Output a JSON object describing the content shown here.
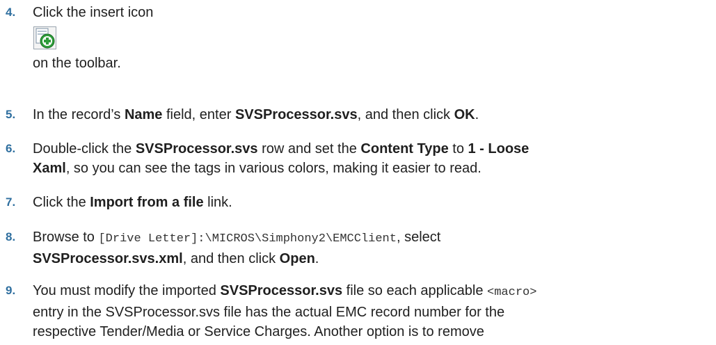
{
  "steps": [
    {
      "num": "4.",
      "text_before": "Click the insert icon",
      "icon": "insert-icon",
      "text_after": "on the toolbar."
    },
    {
      "num": "5.",
      "t1": "In the record’s ",
      "b1": "Name",
      "t2": " field, enter ",
      "b2": "SVSProcessor.svs",
      "t3": ", and then click ",
      "b3": "OK",
      "t4": "."
    },
    {
      "num": "6.",
      "t1": "Double-click the ",
      "b1": "SVSProcessor.svs",
      "t2": " row and set the ",
      "b2": "Content Type",
      "t3": " to ",
      "b3a": "1 - Loose",
      "b3b": "Xaml",
      "t4": ", so you can see the tags in various colors, making it easier to read."
    },
    {
      "num": "7.",
      "t1": "Click the ",
      "b1": "Import from a file",
      "t2": " link."
    },
    {
      "num": "8.",
      "t1": "Browse to ",
      "code": "[Drive Letter]:\\MICROS\\Simphony2\\EMCClient",
      "t2": ", select",
      "b1": "SVSProcessor.svs.xml",
      "t3": ", and then click ",
      "b2": "Open",
      "t4": "."
    },
    {
      "num": "9.",
      "t1": "You must modify the imported ",
      "b1": "SVSProcessor.svs",
      "t2": " file so each applicable ",
      "code": "<macro>",
      "l2": "entry in the SVSProcessor.svs file has the actual EMC record number for the",
      "l3": "respective Tender/Media or Service Charges. Another option is to remove"
    }
  ]
}
